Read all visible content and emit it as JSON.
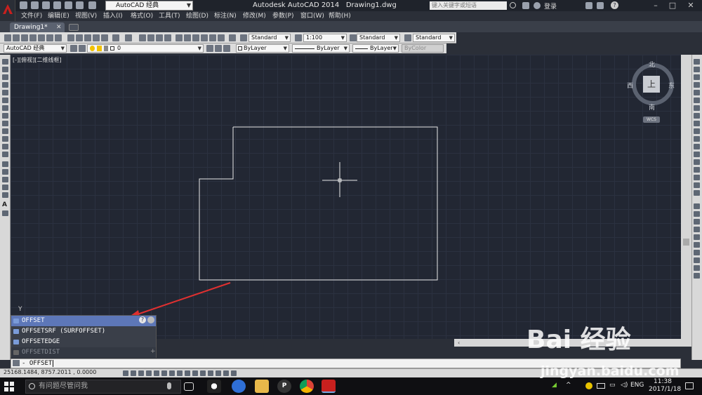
{
  "app": {
    "title": "Autodesk AutoCAD 2014",
    "document": "Drawing1.dwg",
    "workspace": "AutoCAD 经典",
    "search_placeholder": "键入关键字或短语",
    "login_label": "登录"
  },
  "menu": [
    "文件(F)",
    "编辑(E)",
    "视图(V)",
    "插入(I)",
    "格式(O)",
    "工具(T)",
    "绘图(D)",
    "标注(N)",
    "修改(M)",
    "参数(P)",
    "窗口(W)",
    "帮助(H)"
  ],
  "tabs": [
    {
      "label": "Drawing1*"
    }
  ],
  "styles_toolbar": {
    "text_style": "Standard",
    "dim_scale": "1:100",
    "dim_style": "Standard",
    "table_style": "Standard"
  },
  "layers_toolbar": {
    "workspace": "AutoCAD 经典",
    "layer": "0",
    "color": "ByLayer",
    "linetype": "ByLayer",
    "lineweight": "ByLayer",
    "plotstyle": "ByColor"
  },
  "viewport_label": "[-][俯视][二维线框]",
  "viewcube": {
    "face": "上",
    "north": "北",
    "south": "南",
    "east": "东",
    "west": "西",
    "wcs": "WCS"
  },
  "ucs_axis_label": "Y",
  "autocomplete": {
    "items": [
      {
        "label": "OFFSET",
        "selected": true
      },
      {
        "label": "OFFSETSRF (SURFOFFSET)",
        "selected": false
      },
      {
        "label": "OFFSETEDGE",
        "selected": false
      },
      {
        "label": "OFFSETDIST",
        "selected": false,
        "dimmed": true
      }
    ],
    "help_icon": "?"
  },
  "command_line": {
    "prompt": "- OFFSET"
  },
  "status": {
    "coordinates": "25168.1484, 8757.2011 , 0.0000"
  },
  "taskbar": {
    "search_placeholder": "有问题尽管问我",
    "language": "ENG",
    "time": "11:38",
    "date": "2017/1/18"
  },
  "watermark": {
    "brand": "Bai 经验",
    "url": "jingyan.baidu.com"
  },
  "colors": {
    "canvas_bg": "#222733",
    "grid": "#2b3140",
    "selection": "#5d77b8",
    "annotation_arrow": "#e03030"
  }
}
